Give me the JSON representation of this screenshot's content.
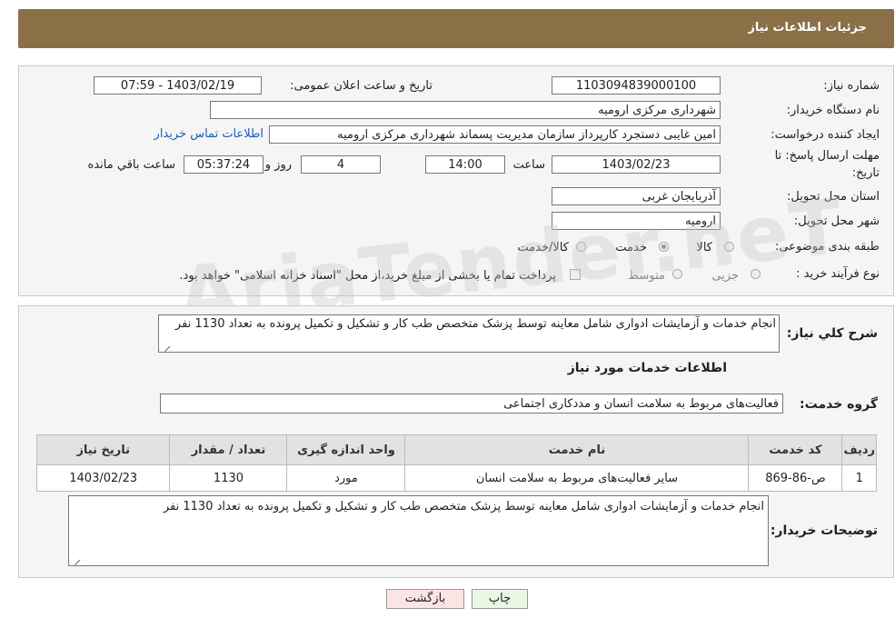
{
  "header": {
    "title": "جزئیات اطلاعات نیاز"
  },
  "need_info": {
    "need_number_label": "شماره نیاز:",
    "need_number": "1103094839000100",
    "announce_label": "تاریخ و ساعت اعلان عمومی:",
    "announce_value": "1403/02/19 - 07:59",
    "buyer_org_label": "نام دستگاه خریدار:",
    "buyer_org": "شهرداری مرکزی ارومیه",
    "creator_label": "ایجاد کننده درخواست:",
    "creator": "امین غایبی دستجرد کارپرداز سازمان مدیریت پسماند شهرداری مرکزی ارومیه",
    "contact_link": "اطلاعات تماس خریدار",
    "deadline_label_1": "مهلت ارسال پاسخ: تا",
    "deadline_label_2": "تاریخ:",
    "deadline_date": "1403/02/23",
    "time_label": "ساعت",
    "deadline_time": "14:00",
    "days_value": "4",
    "days_label": "روز و",
    "remaining_time": "05:37:24",
    "remaining_label": "ساعت باقي مانده",
    "province_label": "استان محل تحویل:",
    "province": "آذربایجان غربی",
    "city_label": "شهر محل تحویل:",
    "city": "ارومیه",
    "category_label": "طبقه بندی موضوعی:",
    "category_options": [
      "کالا",
      "خدمت",
      "کالا/خدمت"
    ],
    "category_selected": "خدمت",
    "process_label": "نوع فرآیند خرید :",
    "process_options": [
      "جزیی",
      "متوسط"
    ],
    "payment_note": "پرداخت تمام یا بخشی از مبلغ خرید،از محل \"اسناد خزانه اسلامی\" خواهد بود."
  },
  "summary": {
    "label": "شرح کلي نياز:",
    "text": "انجام خدمات و آزمایشات ادواری شامل معاینه توسط پزشک متخصص طب کار و تشکیل و تکمیل پرونده به تعداد 1130 نفر"
  },
  "services": {
    "section_title": "اطلاعات خدمات مورد نیاز",
    "group_label": "گروه خدمت:",
    "group_value": "فعالیت‌های مربوط به سلامت انسان و مددکاری اجتماعی",
    "columns": [
      "ردیف",
      "کد خدمت",
      "نام خدمت",
      "واحد اندازه گیری",
      "تعداد / مقدار",
      "تاریخ نیاز"
    ],
    "rows": [
      [
        "1",
        "ص-86-869",
        "سایر فعالیت‌های مربوط به سلامت انسان",
        "مورد",
        "1130",
        "1403/02/23"
      ]
    ]
  },
  "buyer_notes": {
    "label": "توضیحات خریدار:",
    "text": "انجام خدمات و آزمایشات ادواری شامل معاینه توسط پزشک متخصص طب کار و تشکیل و تکمیل پرونده به تعداد 1130 نفر"
  },
  "buttons": {
    "print": "چاپ",
    "back": "بازگشت"
  },
  "watermark": "AriaTender.neT",
  "colors": {
    "header_bg": "#8a6f47",
    "link": "#1a5fb4",
    "print_bg": "#e9f7e4",
    "back_bg": "#fbe4e4"
  }
}
